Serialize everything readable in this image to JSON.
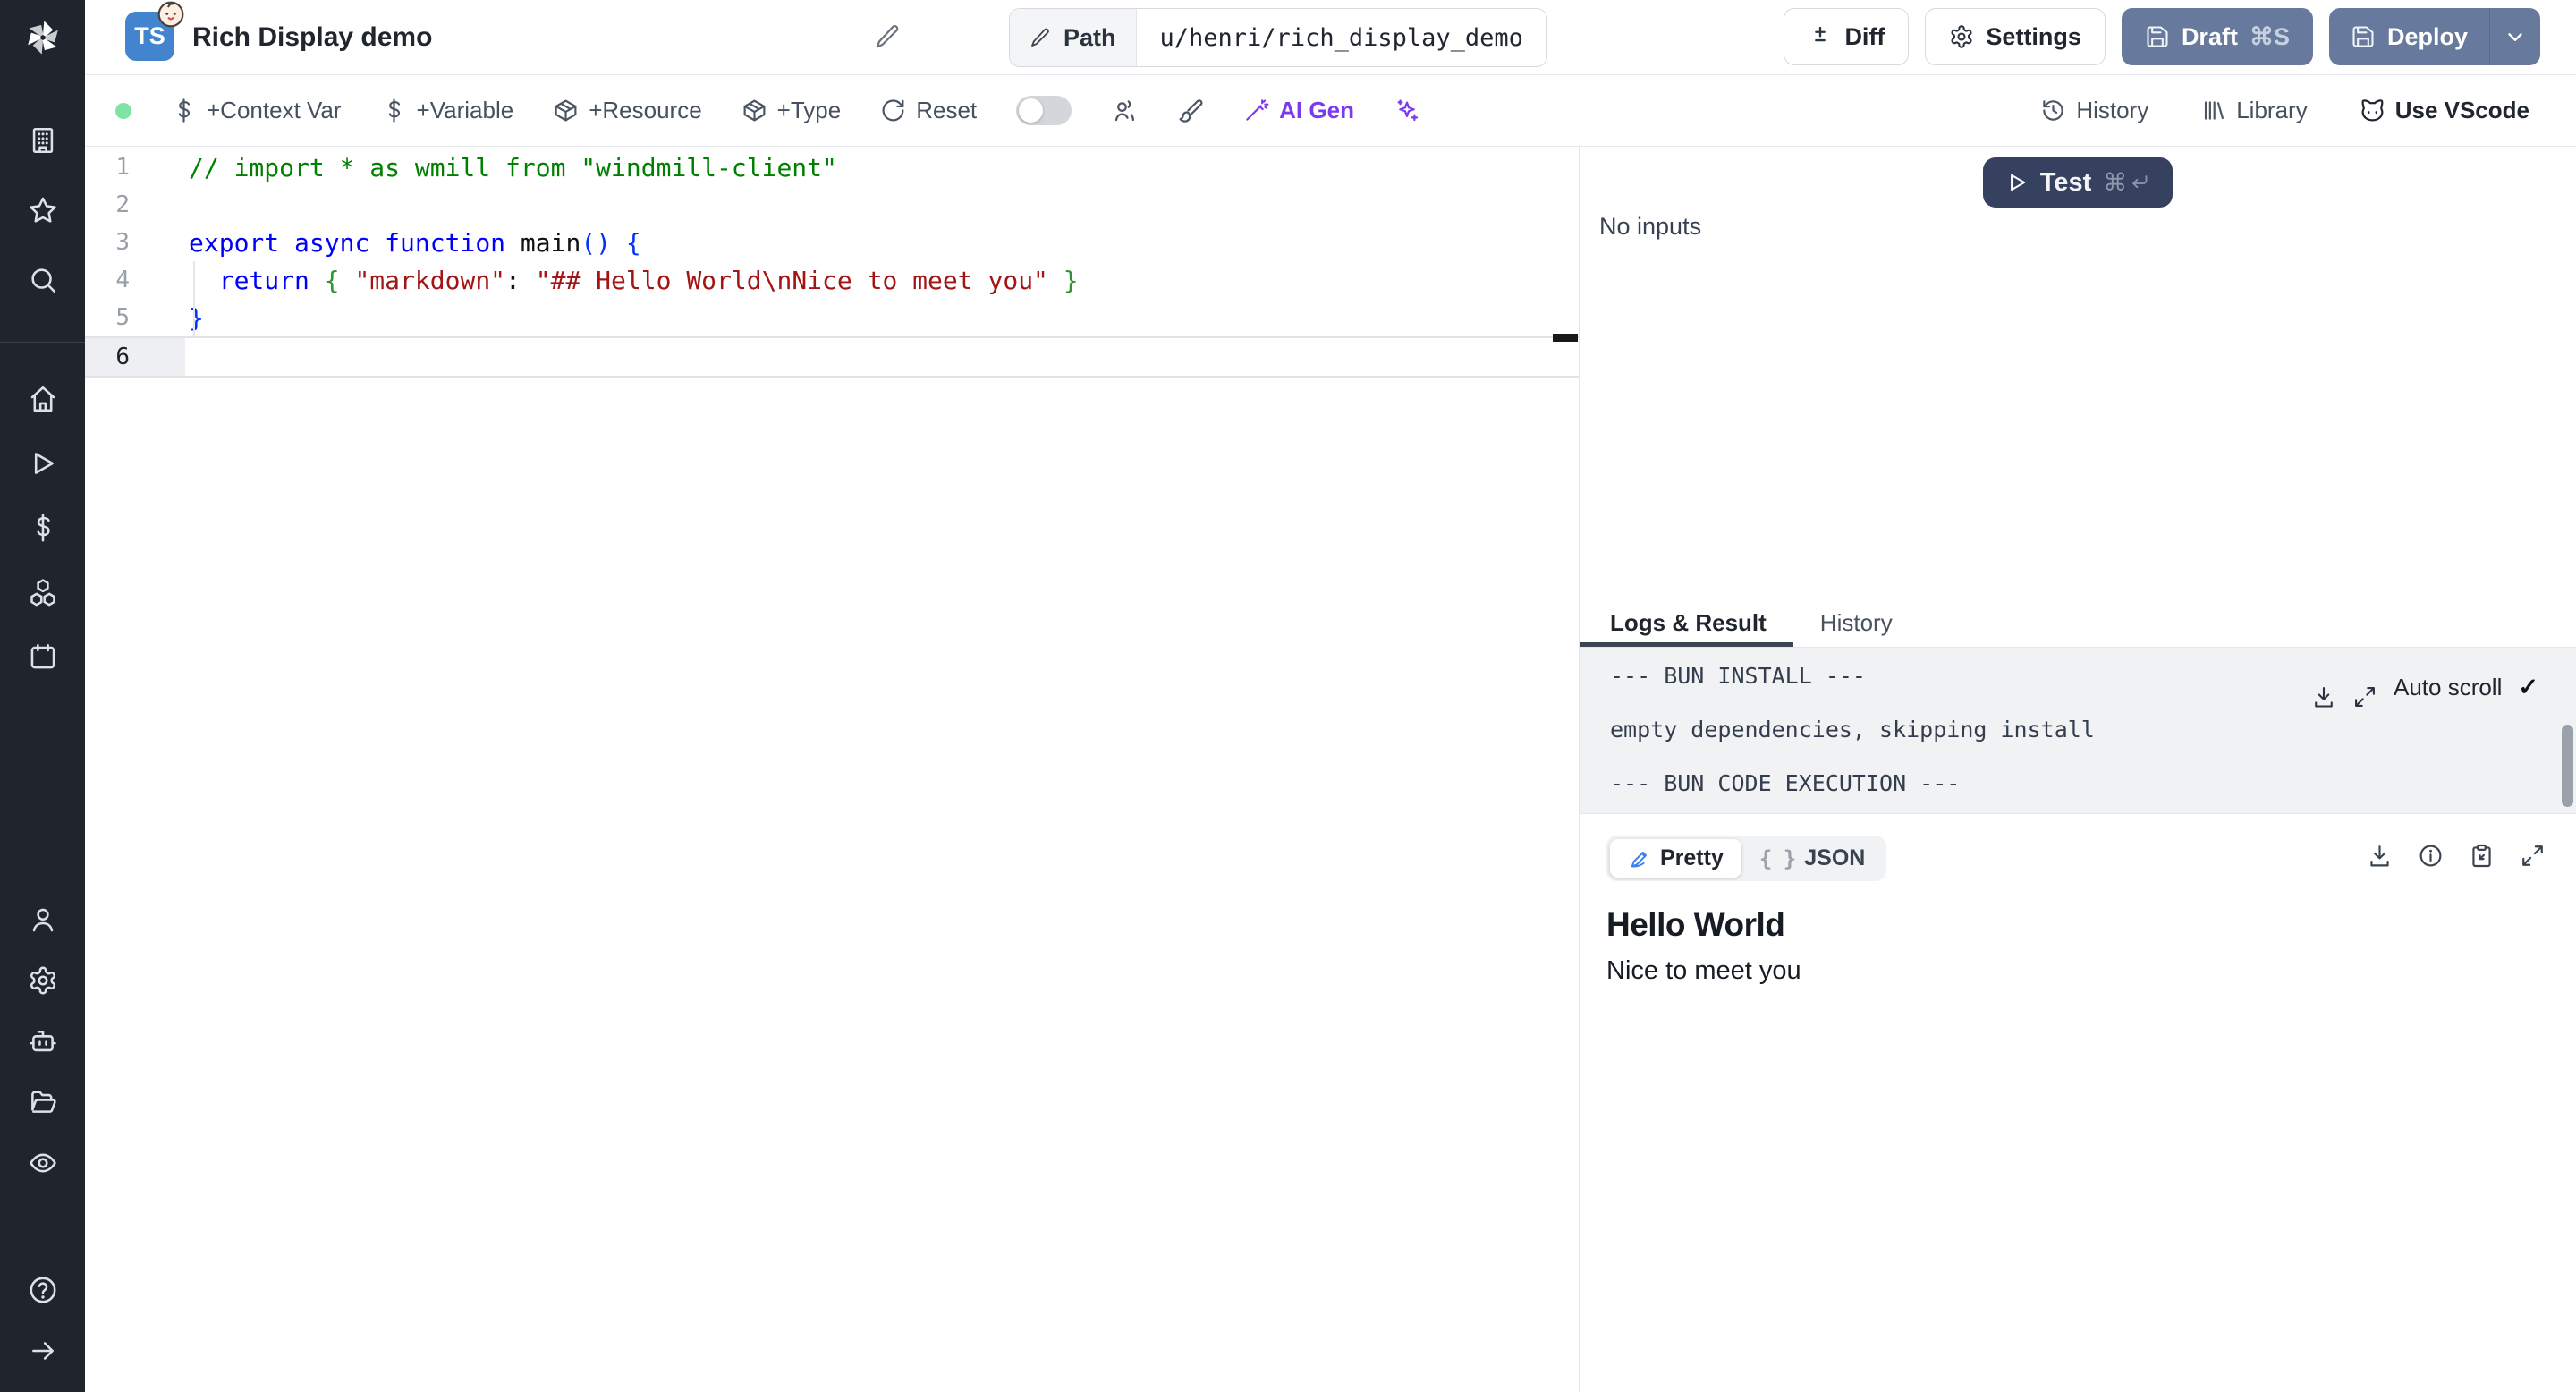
{
  "colors": {
    "slate_button": "#67799c",
    "test_button": "#36415f",
    "ai_purple": "#7c3aed",
    "green_dot": "#7fe3a4",
    "ts_badge": "#4285ce",
    "pretty_pen": "#3b82f6"
  },
  "header": {
    "title": "Rich Display demo",
    "lang_badge": "TS",
    "path_label": "Path",
    "path_value": "u/henri/rich_display_demo",
    "diff": "Diff",
    "settings": "Settings",
    "draft": "Draft",
    "draft_shortcut": "⌘S",
    "deploy": "Deploy"
  },
  "toolbar": {
    "left": [
      {
        "icon": "dollar",
        "label": "+Context Var"
      },
      {
        "icon": "dollar",
        "label": "+Variable"
      },
      {
        "icon": "package",
        "label": "+Resource"
      },
      {
        "icon": "package",
        "label": "+Type"
      },
      {
        "icon": "rotate",
        "label": "Reset"
      }
    ],
    "ai_gen": "AI Gen",
    "right": [
      {
        "icon": "clock-history",
        "label": "History",
        "bold": false
      },
      {
        "icon": "library",
        "label": "Library",
        "bold": false
      },
      {
        "icon": "cat",
        "label": "Use VScode",
        "bold": true
      }
    ]
  },
  "sidebar": {
    "groups": [
      [
        "building",
        "star",
        "search"
      ],
      [
        "home",
        "play",
        "dollar",
        "boxes",
        "calendar"
      ],
      [
        "user",
        "gear",
        "bot",
        "folder-open",
        "eye"
      ],
      [
        "help-circle",
        "arrow-right"
      ]
    ]
  },
  "editor": {
    "lines": [
      {
        "n": "1",
        "tokens": [
          {
            "t": "// import * as wmill from \"windmill-client\"",
            "c": "cmt"
          }
        ],
        "guide": false,
        "active": false
      },
      {
        "n": "2",
        "tokens": [],
        "guide": false,
        "active": false
      },
      {
        "n": "3",
        "tokens": [
          {
            "t": "export",
            "c": "kw"
          },
          {
            "t": " ",
            "c": "pl"
          },
          {
            "t": "async",
            "c": "kw"
          },
          {
            "t": " ",
            "c": "pl"
          },
          {
            "t": "function",
            "c": "kw"
          },
          {
            "t": " ",
            "c": "pl"
          },
          {
            "t": "main",
            "c": "fn"
          },
          {
            "t": "()",
            "c": "br1"
          },
          {
            "t": " ",
            "c": "pl"
          },
          {
            "t": "{",
            "c": "br1"
          }
        ],
        "guide": false,
        "active": false
      },
      {
        "n": "4",
        "tokens": [
          {
            "t": "  ",
            "c": "pl"
          },
          {
            "t": "return",
            "c": "kw"
          },
          {
            "t": " ",
            "c": "pl"
          },
          {
            "t": "{",
            "c": "br2"
          },
          {
            "t": " ",
            "c": "pl"
          },
          {
            "t": "\"markdown\"",
            "c": "str"
          },
          {
            "t": ": ",
            "c": "pl"
          },
          {
            "t": "\"## Hello World\\nNice to meet you\"",
            "c": "str"
          },
          {
            "t": " ",
            "c": "pl"
          },
          {
            "t": "}",
            "c": "br2"
          }
        ],
        "guide": true,
        "active": false
      },
      {
        "n": "5",
        "tokens": [
          {
            "t": "}",
            "c": "br1"
          }
        ],
        "guide": true,
        "active": false
      },
      {
        "n": "6",
        "tokens": [],
        "guide": false,
        "active": true
      }
    ]
  },
  "run": {
    "test": "Test",
    "shortcut_cmd": "⌘",
    "no_inputs": "No inputs"
  },
  "logs": {
    "tab_active": "Logs & Result",
    "tab_inactive": "History",
    "auto_scroll": "Auto scroll",
    "check": "✓",
    "lines": [
      "--- BUN INSTALL ---",
      "empty dependencies, skipping install",
      "--- BUN CODE EXECUTION ---"
    ]
  },
  "result": {
    "pretty": "Pretty",
    "json": "JSON",
    "braces": "{ }",
    "heading": "Hello World",
    "body": "Nice to meet you"
  }
}
